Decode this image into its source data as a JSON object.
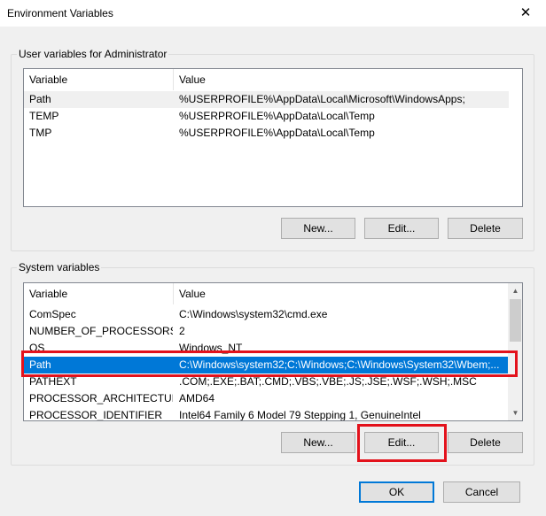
{
  "window": {
    "title": "Environment Variables",
    "close_glyph": "✕"
  },
  "user_section": {
    "label": "User variables for Administrator",
    "columns": {
      "variable": "Variable",
      "value": "Value"
    },
    "rows": [
      {
        "variable": "Path",
        "value": "%USERPROFILE%\\AppData\\Local\\Microsoft\\WindowsApps;"
      },
      {
        "variable": "TEMP",
        "value": "%USERPROFILE%\\AppData\\Local\\Temp"
      },
      {
        "variable": "TMP",
        "value": "%USERPROFILE%\\AppData\\Local\\Temp"
      }
    ],
    "buttons": {
      "new": "New...",
      "edit": "Edit...",
      "delete": "Delete"
    }
  },
  "system_section": {
    "label": "System variables",
    "columns": {
      "variable": "Variable",
      "value": "Value"
    },
    "rows": [
      {
        "variable": "ComSpec",
        "value": "C:\\Windows\\system32\\cmd.exe"
      },
      {
        "variable": "NUMBER_OF_PROCESSORS",
        "value": "2"
      },
      {
        "variable": "OS",
        "value": "Windows_NT"
      },
      {
        "variable": "Path",
        "value": "C:\\Windows\\system32;C:\\Windows;C:\\Windows\\System32\\Wbem;..."
      },
      {
        "variable": "PATHEXT",
        "value": ".COM;.EXE;.BAT;.CMD;.VBS;.VBE;.JS;.JSE;.WSF;.WSH;.MSC"
      },
      {
        "variable": "PROCESSOR_ARCHITECTURE",
        "value": "AMD64"
      },
      {
        "variable": "PROCESSOR_IDENTIFIER",
        "value": "Intel64 Family 6 Model 79 Stepping 1, GenuineIntel"
      }
    ],
    "selected_row": "Path",
    "buttons": {
      "new": "New...",
      "edit": "Edit...",
      "delete": "Delete"
    }
  },
  "footer": {
    "ok": "OK",
    "cancel": "Cancel"
  },
  "colors": {
    "selection": "#0078d7",
    "highlight_box": "#e3121c"
  }
}
